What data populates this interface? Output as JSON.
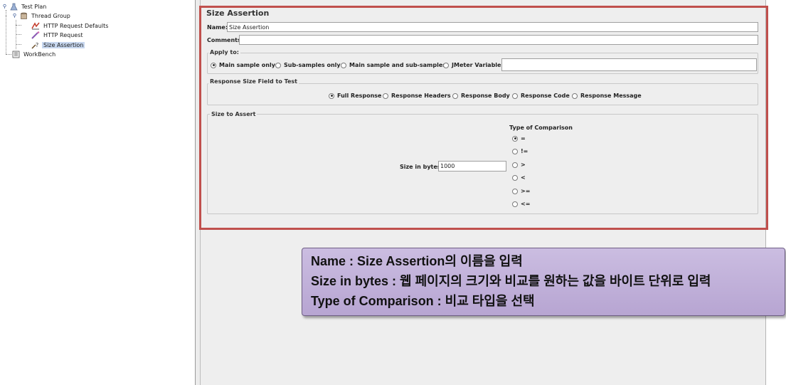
{
  "tree": {
    "items": [
      {
        "label": "Test Plan",
        "icon": "test-plan-icon"
      },
      {
        "label": "Thread Group",
        "icon": "thread-group-icon"
      },
      {
        "label": "HTTP Request Defaults",
        "icon": "config-element-icon"
      },
      {
        "label": "HTTP Request",
        "icon": "sampler-icon"
      },
      {
        "label": "Size Assertion",
        "icon": "assertion-icon"
      },
      {
        "label": "WorkBench",
        "icon": "workbench-icon"
      }
    ],
    "selected": "Size Assertion"
  },
  "panel": {
    "title": "Size Assertion",
    "name_label": "Name:",
    "name_value": "Size Assertion",
    "comments_label": "Comments:",
    "comments_value": "",
    "apply_to": {
      "legend": "Apply to:",
      "options": [
        "Main sample only",
        "Sub-samples only",
        "Main sample and sub-samples",
        "JMeter Variable"
      ],
      "selected": "Main sample only",
      "variable_value": ""
    },
    "response_field": {
      "legend": "Response Size Field to Test",
      "options": [
        "Full Response",
        "Response Headers",
        "Response Body",
        "Response Code",
        "Response Message"
      ],
      "selected": "Full Response"
    },
    "size_to_assert": {
      "legend": "Size to Assert",
      "size_label": "Size in bytes:",
      "size_value": "1000",
      "comparison_title": "Type of Comparison",
      "comparisons": [
        "=",
        "!=",
        ">",
        "<",
        ">=",
        "<="
      ],
      "selected": "="
    }
  },
  "callout": {
    "lines": [
      "Name : Size Assertion의 이름을 입력",
      "Size in bytes : 웹 페이지의 크기와 비교를 원하는 값을 바이트 단위로 입력",
      "Type of Comparison : 비교 타입을 선택"
    ]
  },
  "colors": {
    "highlight_border": "#c0504d",
    "callout_bg": "#c3b3dc",
    "selection": "#c7d7ef"
  }
}
